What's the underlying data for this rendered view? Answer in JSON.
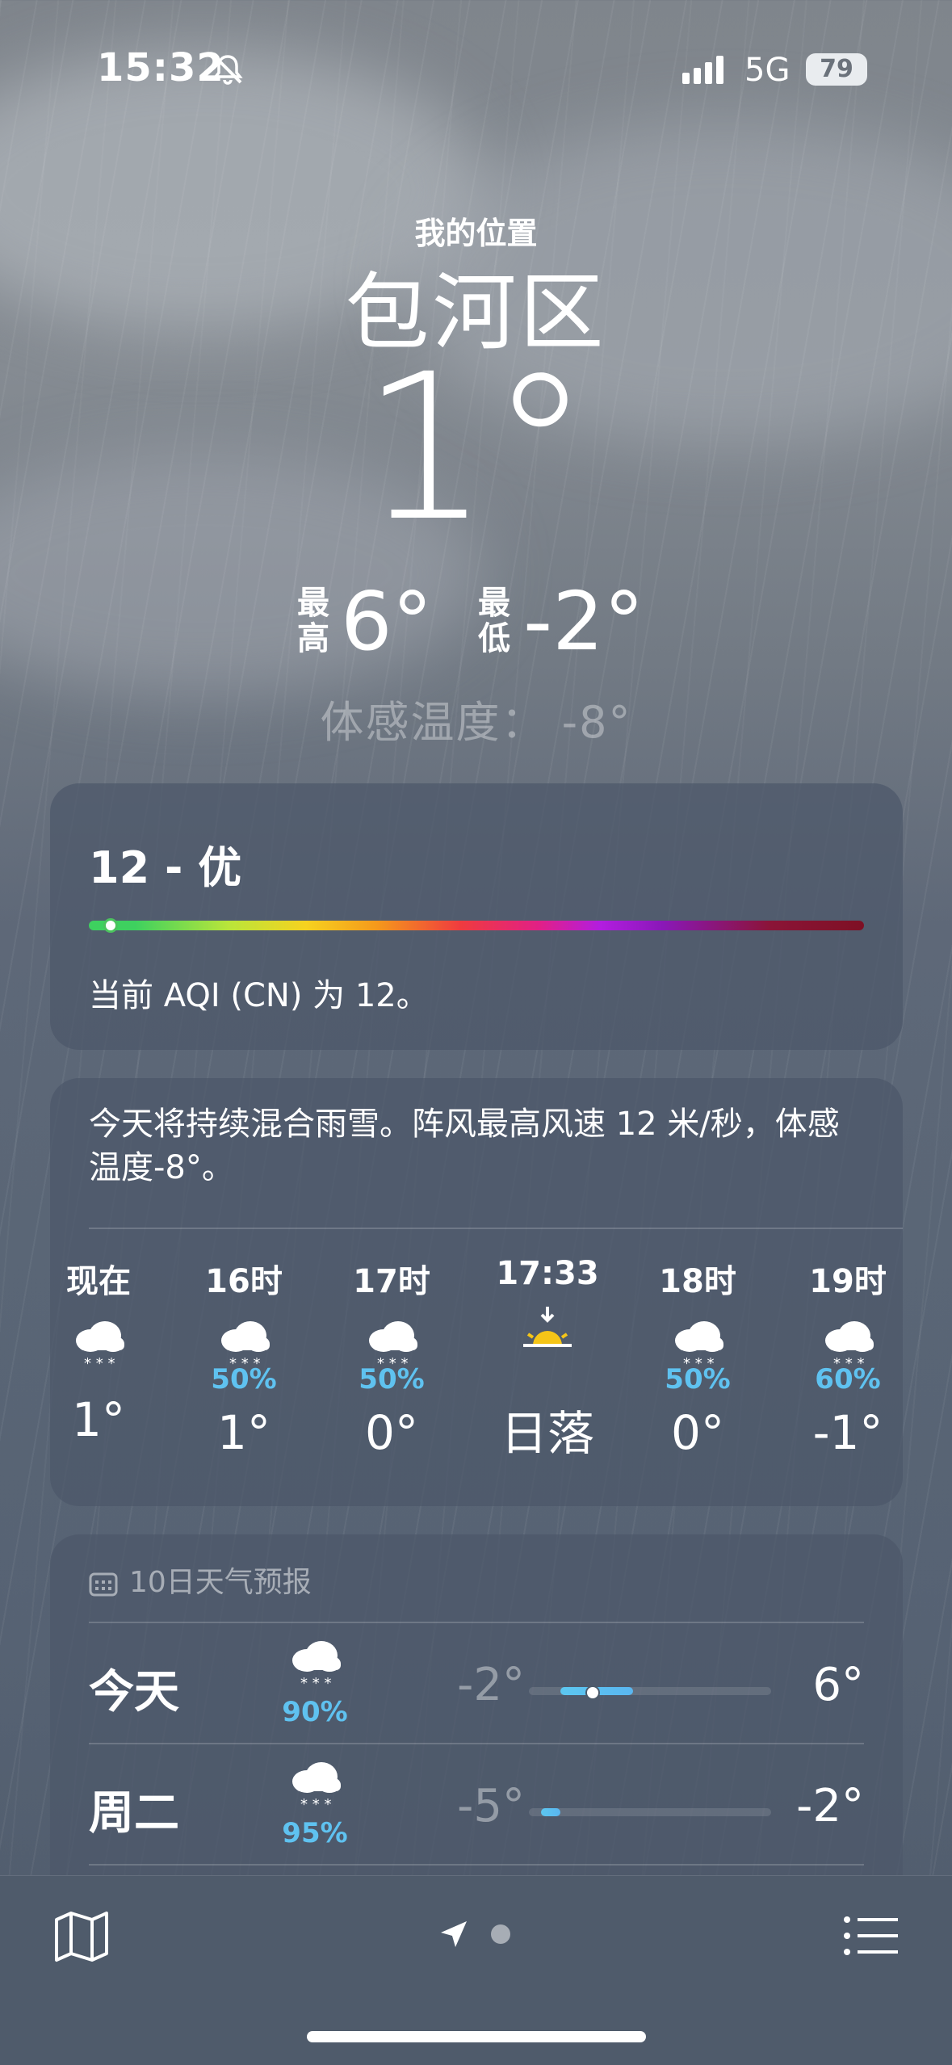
{
  "status": {
    "time": "15:32",
    "network": "5G",
    "battery": "79"
  },
  "location": {
    "label": "我的位置",
    "city": "包河区"
  },
  "current": {
    "temp": "1°",
    "high_label": "最高",
    "high": "6°",
    "low_label": "最低",
    "low": "-2°",
    "feels_like_label": "体感温度",
    "feels_like": "-8°"
  },
  "aqi": {
    "title": "12 - 优",
    "description": "当前 AQI (CN) 为 12。",
    "value": 12
  },
  "forecast": {
    "summary": "今天将持续混合雨雪。阵风最高风速 12 米/秒，体感温度-8°。",
    "hours": [
      {
        "label": "现在",
        "icon": "sleet-cloud-icon",
        "pct": "",
        "temp": "1°"
      },
      {
        "label": "16时",
        "icon": "sleet-cloud-icon",
        "pct": "50%",
        "temp": "1°"
      },
      {
        "label": "17时",
        "icon": "sleet-cloud-icon",
        "pct": "50%",
        "temp": "0°"
      },
      {
        "label": "17:33",
        "icon": "sunset-icon",
        "pct": "",
        "temp": "日落"
      },
      {
        "label": "18时",
        "icon": "sleet-cloud-icon",
        "pct": "50%",
        "temp": "0°"
      },
      {
        "label": "19时",
        "icon": "sleet-cloud-icon",
        "pct": "60%",
        "temp": "-1°"
      }
    ]
  },
  "ten_day": {
    "title": "10日天气预报",
    "days": [
      {
        "day": "今天",
        "icon": "sleet-cloud-icon",
        "pct": "90%",
        "low": "-2°",
        "high": "6°",
        "range_start": 0.13,
        "range_end": 0.43,
        "now": 0.26
      },
      {
        "day": "周二",
        "icon": "sleet-cloud-icon",
        "pct": "95%",
        "low": "-5°",
        "high": "-2°",
        "range_start": 0.05,
        "range_end": 0.13
      }
    ]
  },
  "tabbar": {
    "left_icon": "map-icon",
    "center_icon": "location-arrow-icon",
    "right_icon": "list-icon"
  }
}
